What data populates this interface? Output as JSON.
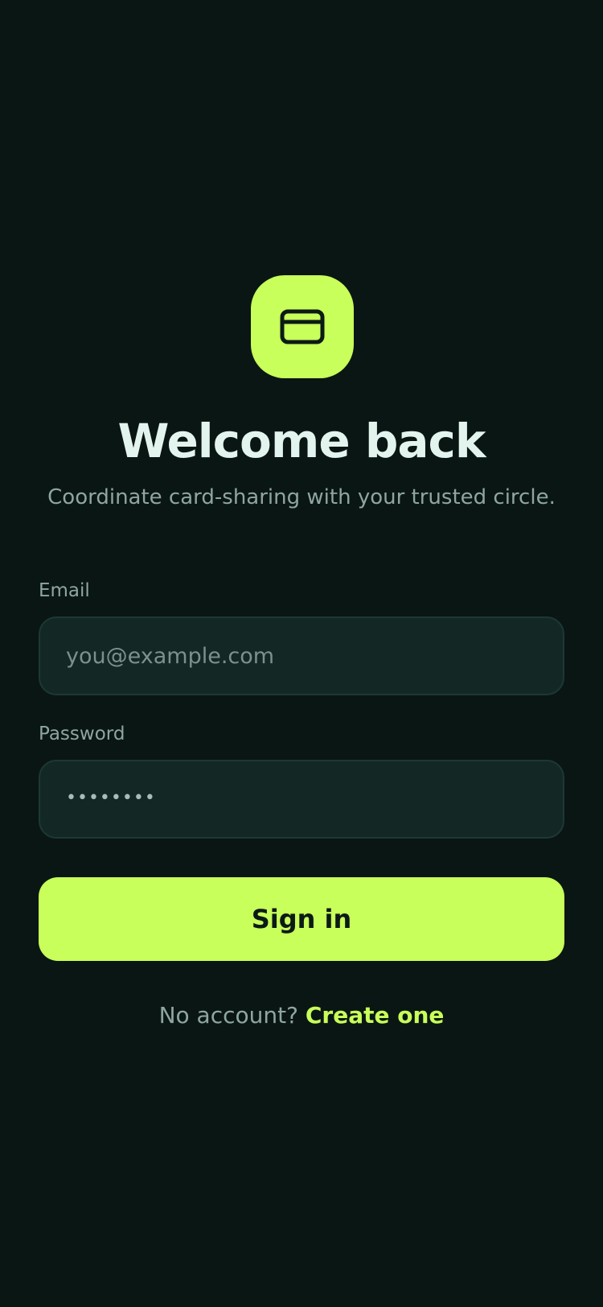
{
  "brand": {
    "icon": "credit-card-icon",
    "accent_color": "#c8ff5a",
    "background_color": "#0a1614"
  },
  "header": {
    "title": "Welcome back",
    "subtitle": "Coordinate card-sharing with your trusted circle."
  },
  "form": {
    "email": {
      "label": "Email",
      "placeholder": "you@example.com",
      "value": ""
    },
    "password": {
      "label": "Password",
      "masked_value": "••••••••"
    },
    "submit_label": "Sign in"
  },
  "footer": {
    "prompt": "No account?",
    "link_label": "Create one"
  }
}
